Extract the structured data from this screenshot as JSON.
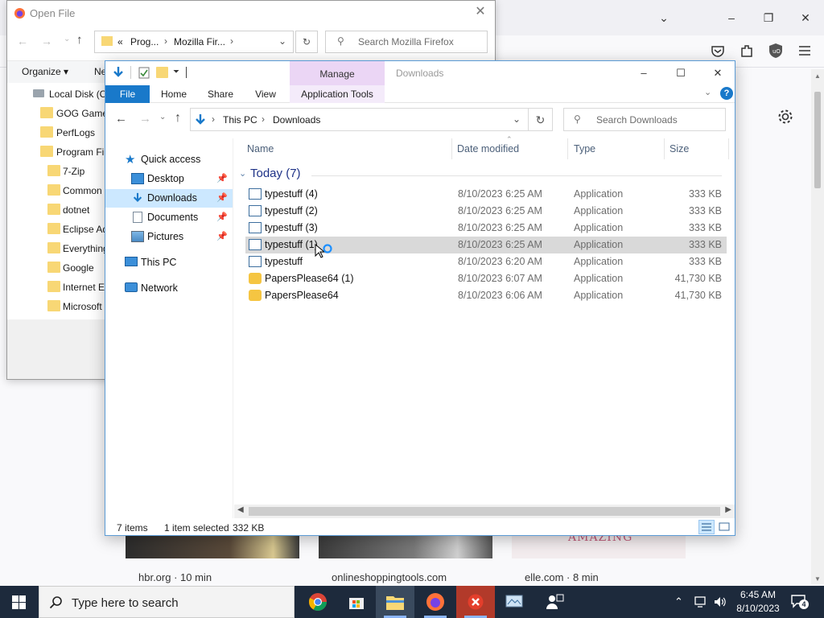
{
  "firefox": {
    "cards": [
      {
        "label": "hbr.org · 10 min"
      },
      {
        "label": "onlineshoppingtools.com"
      },
      {
        "label": "elle.com · 8 min"
      }
    ],
    "card_text_overlay": "AMAZING"
  },
  "open_dialog": {
    "title": "Open File",
    "breadcrumb_prefix": "«",
    "breadcrumb": [
      "Prog...",
      "Mozilla Fir...",
      ""
    ],
    "search_placeholder": "Search Mozilla Firefox",
    "organize_label": "Organize ▾",
    "new_label": "Ne",
    "tree": [
      {
        "label": "Local Disk (C:)"
      },
      {
        "label": "GOG Games"
      },
      {
        "label": "PerfLogs"
      },
      {
        "label": "Program Files"
      },
      {
        "label": "7-Zip"
      },
      {
        "label": "Common"
      },
      {
        "label": "dotnet"
      },
      {
        "label": "Eclipse Ad"
      },
      {
        "label": "Everything"
      },
      {
        "label": "Google"
      },
      {
        "label": "Internet Ex"
      },
      {
        "label": "Microsoft"
      }
    ]
  },
  "explorer": {
    "manage_tab": "Manage",
    "title": "Downloads",
    "ribbon_tabs": {
      "file": "File",
      "home": "Home",
      "share": "Share",
      "view": "View",
      "app_tools": "Application Tools"
    },
    "breadcrumb": {
      "this_pc": "This PC",
      "downloads": "Downloads"
    },
    "search_placeholder": "Search Downloads",
    "sidebar": {
      "quick_access": "Quick access",
      "desktop": "Desktop",
      "downloads": "Downloads",
      "documents": "Documents",
      "pictures": "Pictures",
      "this_pc": "This PC",
      "network": "Network"
    },
    "columns": {
      "name": "Name",
      "date": "Date modified",
      "type": "Type",
      "size": "Size"
    },
    "group_header": "Today (7)",
    "files": [
      {
        "name": "typestuff (4)",
        "date": "8/10/2023 6:25 AM",
        "type": "Application",
        "size": "333 KB"
      },
      {
        "name": "typestuff (2)",
        "date": "8/10/2023 6:25 AM",
        "type": "Application",
        "size": "333 KB"
      },
      {
        "name": "typestuff (3)",
        "date": "8/10/2023 6:25 AM",
        "type": "Application",
        "size": "333 KB"
      },
      {
        "name": "typestuff (1)",
        "date": "8/10/2023 6:25 AM",
        "type": "Application",
        "size": "333 KB"
      },
      {
        "name": "typestuff",
        "date": "8/10/2023 6:20 AM",
        "type": "Application",
        "size": "333 KB"
      },
      {
        "name": "PapersPlease64 (1)",
        "date": "8/10/2023 6:07 AM",
        "type": "Application",
        "size": "41,730 KB"
      },
      {
        "name": "PapersPlease64",
        "date": "8/10/2023 6:06 AM",
        "type": "Application",
        "size": "41,730 KB"
      }
    ],
    "status": {
      "items": "7 items",
      "selected": "1 item selected",
      "size": "332 KB"
    }
  },
  "taskbar": {
    "search_placeholder": "Type here to search",
    "time": "6:45 AM",
    "date": "8/10/2023",
    "notification_count": "4"
  },
  "colors": {
    "accent_blue": "#1979ca",
    "manage_tab": "#ebd6f5",
    "selection": "#cce8ff",
    "taskbar": "#1d2a3c"
  }
}
